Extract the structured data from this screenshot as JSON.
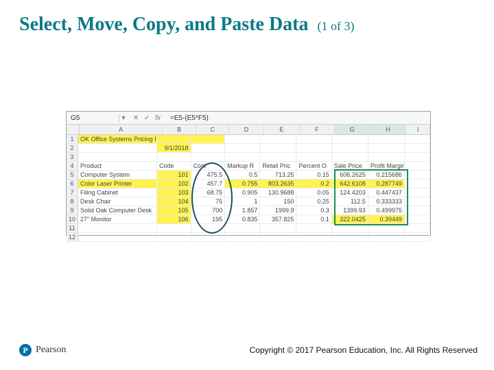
{
  "title": {
    "main": "Select, Move, Copy, and Paste Data",
    "part": "(1 of 3)"
  },
  "formula_bar": {
    "namebox": "G5",
    "fx_label": "fx",
    "formula": "=E5-(E5*F5)",
    "cancel_glyph": "✕",
    "enter_glyph": "✓"
  },
  "col_headers": [
    "A",
    "B",
    "C",
    "D",
    "E",
    "F",
    "G",
    "H",
    "I"
  ],
  "rows": {
    "r1": {
      "a": "OK Office Systems Pricing Information"
    },
    "r2": {
      "a": "",
      "b": "9/1/2018"
    },
    "r4": {
      "a": "Product",
      "b": "Code",
      "c": "Cost",
      "d": "Markup R",
      "e": "Retail Pric",
      "f": "Percent O",
      "g": "Sale Price",
      "h": "Profit Margin"
    },
    "r5": {
      "a": "Computer System",
      "b": "101",
      "c": "475.5",
      "d": "0.5",
      "e": "713.25",
      "f": "0.15",
      "g": "606.2625",
      "h": "0.215686"
    },
    "r6": {
      "a": "Color Laser Printer",
      "b": "102",
      "c": "457.7",
      "d": "0.755",
      "e": "803.2635",
      "f": "0.2",
      "g": "642.6108",
      "h": "0.287749"
    },
    "r7": {
      "a": "Filing Cabinet",
      "b": "103",
      "c": "68.75",
      "d": "0.905",
      "e": "130.9688",
      "f": "0.05",
      "g": "124.4203",
      "h": "0.447437"
    },
    "r8": {
      "a": "Desk Chair",
      "b": "104",
      "c": "75",
      "d": "1",
      "e": "150",
      "f": "0.25",
      "g": "112.5",
      "h": "0.333333"
    },
    "r9": {
      "a": "Solid Oak Computer Desk",
      "b": "105",
      "c": "700",
      "d": "1.857",
      "e": "1999.9",
      "f": "0.3",
      "g": "1399.93",
      "h": "0.499975"
    },
    "r10": {
      "a": "27\" Monitor",
      "b": "106",
      "c": "195",
      "d": "0.835",
      "e": "357.825",
      "f": "0.1",
      "g": "322.0425",
      "h": "0.39449"
    }
  },
  "row_numbers": [
    "1",
    "2",
    "3",
    "4",
    "5",
    "6",
    "7",
    "8",
    "9",
    "10",
    "11",
    "12"
  ],
  "footer": {
    "brand": "Pearson",
    "brand_mark": "P",
    "copyright": "Copyright © 2017 Pearson Education, Inc. All Rights Reserved"
  }
}
